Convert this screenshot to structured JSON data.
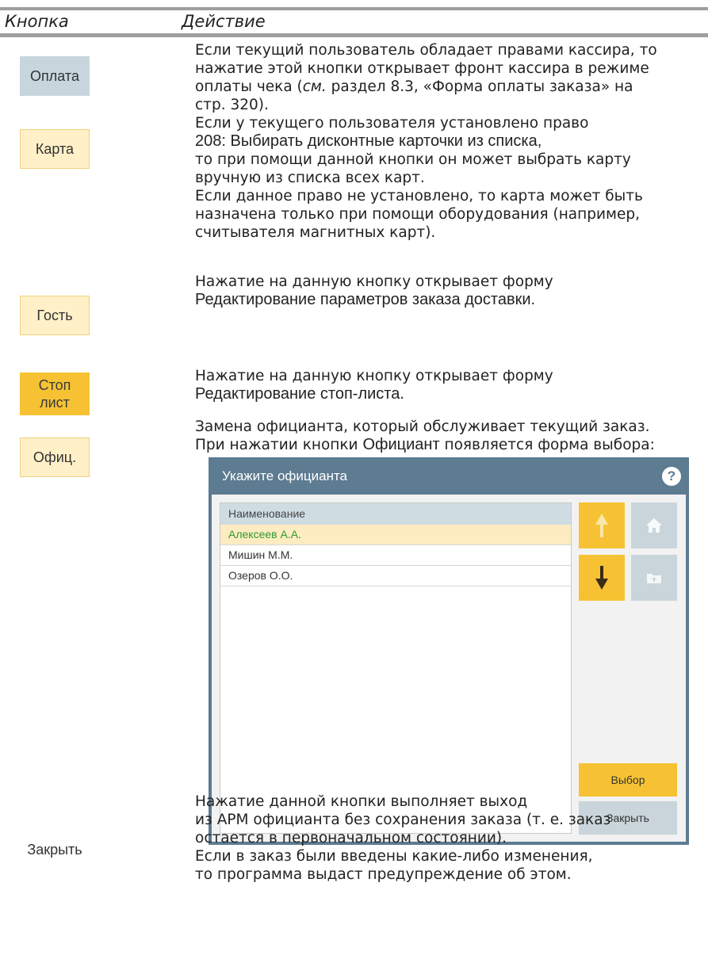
{
  "table": {
    "header_button": "Кнопка",
    "header_action": "Действие"
  },
  "rows": [
    {
      "button": "Оплата",
      "lines": [
        "Если текущий пользователь обладает правами кассира, то",
        "нажатие этой кнопки открывает фронт кассира в режиме",
        "оплаты чека (",
        "см.",
        " раздел 8.3, «Форма оплаты заказа» на",
        "стр. 320)."
      ]
    },
    {
      "button": "Карта",
      "lines": [
        "Если у текущего пользователя установлено право",
        "208: Выбирать дисконтные карточки из списка,",
        "то при помощи данной кнопки он может выбрать карту",
        "вручную из списка всех карт.",
        "Если данное право не установлено, то карта может быть",
        "назначена только при помощи оборудования (например,",
        "считывателя магнитных карт)."
      ]
    },
    {
      "button": "Гость",
      "lines": [
        "Нажатие на данную кнопку открывает форму",
        "Редактирование параметров заказа доставки."
      ]
    },
    {
      "button_line1": "Стоп",
      "button_line2": "лист",
      "lines": [
        "Нажатие на данную кнопку открывает форму",
        "Редактирование стоп-листа."
      ]
    },
    {
      "button": "Офиц.",
      "lines": [
        "Замена официанта, который обслуживает текущий заказ.",
        "При нажатии кнопки ",
        "Официант",
        " появляется форма выбора:"
      ]
    },
    {
      "button": "Закрыть",
      "lines": [
        "Нажатие данной кнопки выполняет выход",
        "из АРМ официанта без сохранения заказа (т. е. заказ",
        "остается в первоначальном состоянии).",
        "Если в заказ были введены какие-либо изменения,",
        "то программа выдаст предупреждение об этом."
      ]
    }
  ],
  "dialog": {
    "title": "Укажите официанта",
    "help_glyph": "?",
    "column_header": "Наименование",
    "items": [
      "Алексеев А.А.",
      "Мишин М.М.",
      "Озеров О.О."
    ],
    "select_label": "Выбор",
    "close_label": "Закрыть"
  },
  "colors": {
    "accent_gold": "#f6c233",
    "dialog_header": "#5d7b91",
    "selected_text": "#2e9a2e"
  }
}
